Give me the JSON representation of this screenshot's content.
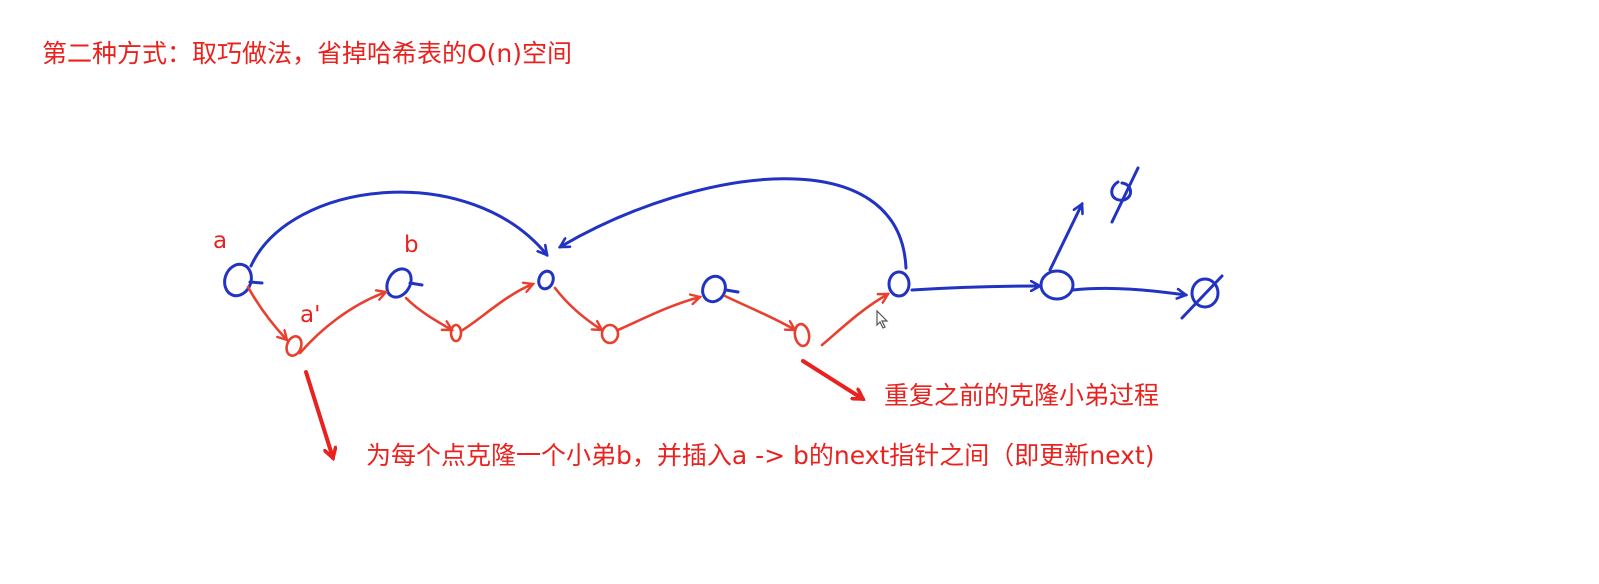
{
  "title": "第二种方式：取巧做法，省掉哈希表的O(n)空间",
  "labels": {
    "a": "a",
    "b": "b",
    "a_prime": "a'"
  },
  "notes": {
    "repeat": "重复之前的克隆小弟过程",
    "clone": "为每个点克隆一个小弟b，并插入a -> b的next指针之间（即更新next)"
  },
  "colors": {
    "annotation_red": "#e8231f",
    "clone_red": "#e8402f",
    "original_blue": "#2233c4"
  }
}
